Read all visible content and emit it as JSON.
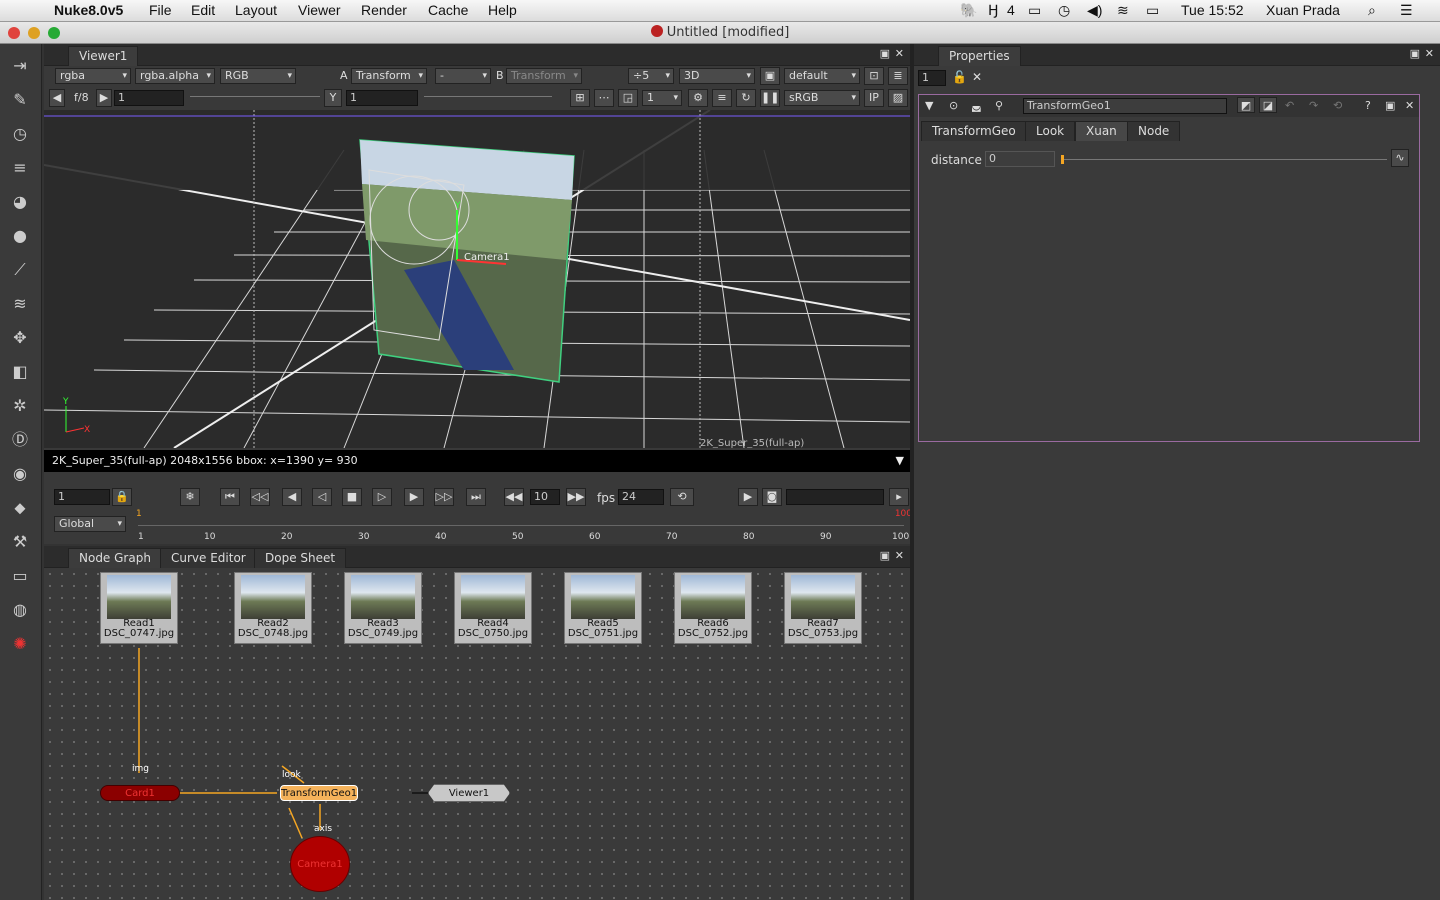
{
  "menubar": {
    "app": "Nuke8.0v5",
    "items": [
      "File",
      "Edit",
      "Layout",
      "Viewer",
      "Render",
      "Cache",
      "Help"
    ],
    "status_num": "4",
    "clock": "Tue 15:52",
    "user": "Xuan Prada"
  },
  "window": {
    "title": "Untitled [modified]"
  },
  "viewer": {
    "tab": "Viewer1",
    "channels": "rgba",
    "alpha": "rgba.alpha",
    "colorspace": "RGB",
    "a_label": "A",
    "a_input": "Transform",
    "a_op": "-",
    "b_label": "B",
    "b_input": "Transform",
    "downrez": "÷5",
    "view_mode": "3D",
    "lut": "default",
    "fstop": "f/8",
    "gain": "1",
    "y_label": "Y",
    "gamma": "1",
    "proxy": "1",
    "display": "sRGB",
    "ip": "IP",
    "format_label": "2K_Super_35(full-ap)",
    "info": "2K_Super_35(full-ap) 2048x1556 bbox:   x=1390 y= 930",
    "camera_label": "Camera1",
    "axis_y": "Y",
    "axis_x": "X"
  },
  "timeline": {
    "frame": "1",
    "increment": "10",
    "fps_label": "fps",
    "fps": "24",
    "range_mode": "Global",
    "ticks": [
      "1",
      "10",
      "20",
      "30",
      "40",
      "50",
      "60",
      "70",
      "80",
      "90",
      "100"
    ],
    "start_marker": "1",
    "end_marker": "100"
  },
  "nodegraph": {
    "tabs": [
      "Node Graph",
      "Curve Editor",
      "Dope Sheet"
    ],
    "reads": [
      {
        "name": "Read1",
        "file": "DSC_0747.jpg"
      },
      {
        "name": "Read2",
        "file": "DSC_0748.jpg"
      },
      {
        "name": "Read3",
        "file": "DSC_0749.jpg"
      },
      {
        "name": "Read4",
        "file": "DSC_0750.jpg"
      },
      {
        "name": "Read5",
        "file": "DSC_0751.jpg"
      },
      {
        "name": "Read6",
        "file": "DSC_0752.jpg"
      },
      {
        "name": "Read7",
        "file": "DSC_0753.jpg"
      }
    ],
    "card": "Card1",
    "img_label": "img",
    "transform": "TransformGeo1",
    "look_label": "look",
    "axis_label": "axis",
    "viewer": "Viewer1",
    "camera": "Camera1"
  },
  "properties": {
    "tab": "Properties",
    "max_panels": "1",
    "node_name": "TransformGeo1",
    "tabs": [
      "TransformGeo",
      "Look",
      "Xuan",
      "Node"
    ],
    "knob_label": "distance",
    "knob_value": "0",
    "slider_ticks": [
      "0",
      "1",
      "2",
      "3",
      "4",
      "5",
      "6",
      "7",
      "8",
      "9",
      "10"
    ]
  },
  "colors": {
    "accent": "#f5a623",
    "card": "#8b0000",
    "camera": "#b00000",
    "grid": "#cfcfcf",
    "selection": "#40d080"
  }
}
